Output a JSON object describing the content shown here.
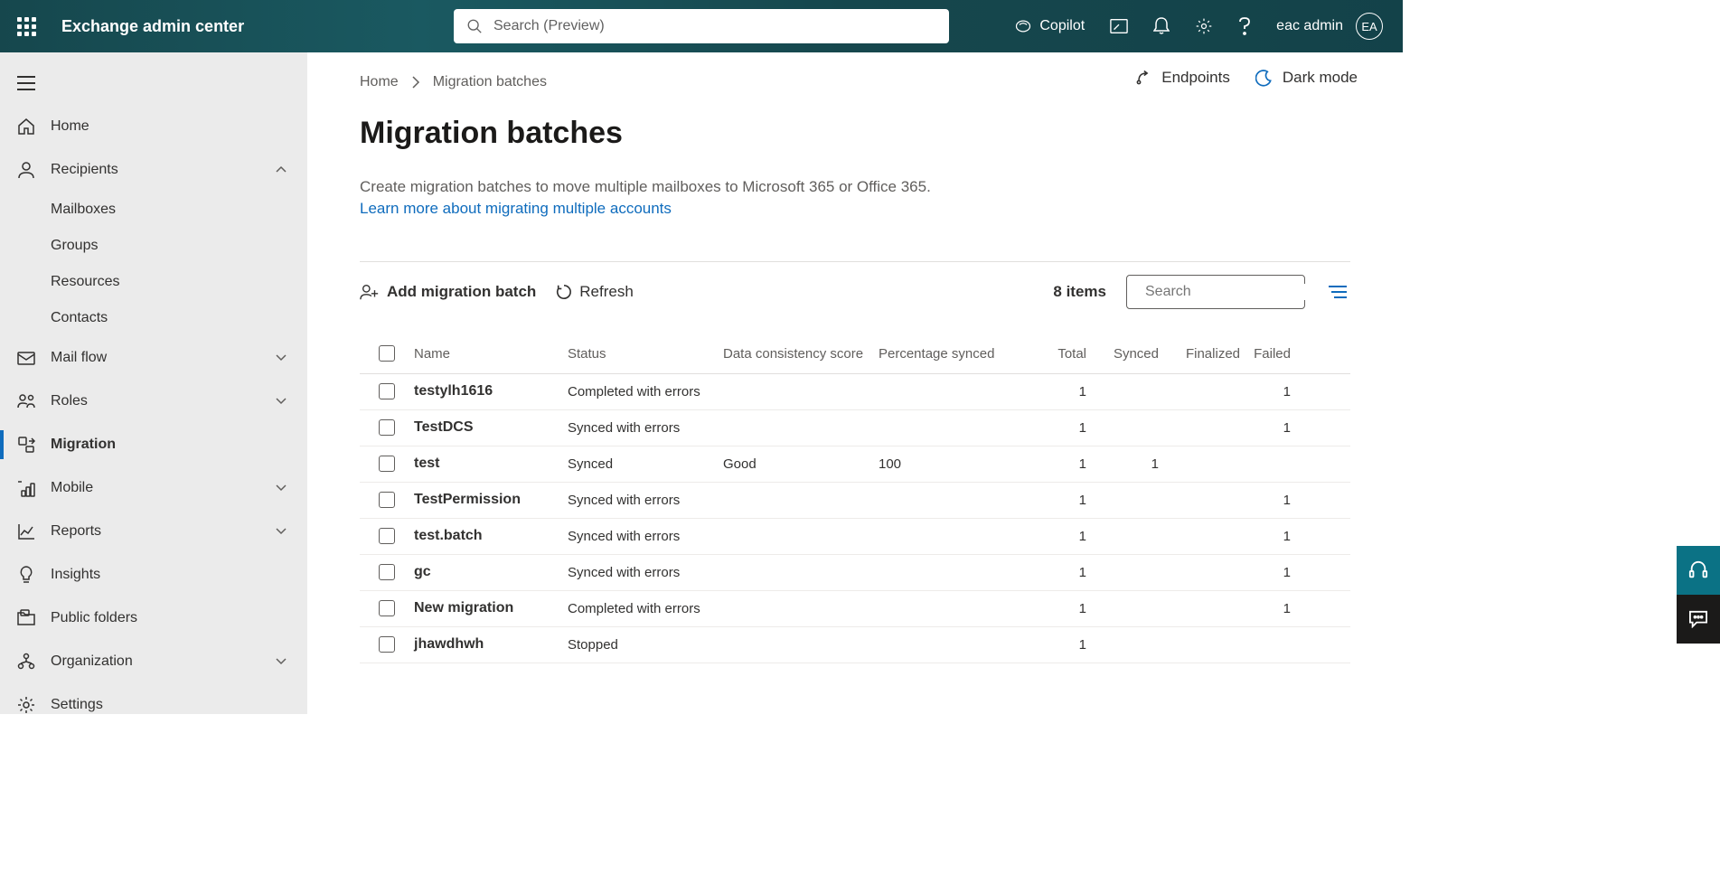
{
  "header": {
    "app_title": "Exchange admin center",
    "search_placeholder": "Search (Preview)",
    "copilot_label": "Copilot",
    "user_name": "eac admin",
    "user_initials": "EA"
  },
  "sidebar": {
    "items": [
      {
        "label": "Home",
        "icon": "home"
      },
      {
        "label": "Recipients",
        "icon": "person",
        "expanded": true,
        "children": [
          "Mailboxes",
          "Groups",
          "Resources",
          "Contacts"
        ]
      },
      {
        "label": "Mail flow",
        "icon": "mail",
        "expandable": true
      },
      {
        "label": "Roles",
        "icon": "roles",
        "expandable": true
      },
      {
        "label": "Migration",
        "icon": "migration",
        "active": true
      },
      {
        "label": "Mobile",
        "icon": "mobile",
        "expandable": true
      },
      {
        "label": "Reports",
        "icon": "chart",
        "expandable": true
      },
      {
        "label": "Insights",
        "icon": "bulb"
      },
      {
        "label": "Public folders",
        "icon": "folder"
      },
      {
        "label": "Organization",
        "icon": "org",
        "expandable": true
      },
      {
        "label": "Settings",
        "icon": "gear"
      }
    ]
  },
  "breadcrumb": {
    "home": "Home",
    "current": "Migration batches"
  },
  "page": {
    "title": "Migration batches",
    "description": "Create migration batches to move multiple mailboxes to Microsoft 365 or Office 365.",
    "learn_more": "Learn more about migrating multiple accounts",
    "endpoints_label": "Endpoints",
    "dark_mode_label": "Dark mode"
  },
  "toolbar": {
    "add_label": "Add migration batch",
    "refresh_label": "Refresh",
    "item_count_label": "8 items",
    "search_placeholder": "Search"
  },
  "table": {
    "columns": [
      "Name",
      "Status",
      "Data consistency score",
      "Percentage synced",
      "Total",
      "Synced",
      "Finalized",
      "Failed"
    ],
    "rows": [
      {
        "name": "testylh1616",
        "status": "Completed with errors",
        "dcs": "",
        "pct": "",
        "total": "1",
        "synced": "",
        "finalized": "",
        "failed": "1"
      },
      {
        "name": "TestDCS",
        "status": "Synced with errors",
        "dcs": "",
        "pct": "",
        "total": "1",
        "synced": "",
        "finalized": "",
        "failed": "1"
      },
      {
        "name": "test",
        "status": "Synced",
        "dcs": "Good",
        "pct": "100",
        "total": "1",
        "synced": "1",
        "finalized": "",
        "failed": ""
      },
      {
        "name": "TestPermission",
        "status": "Synced with errors",
        "dcs": "",
        "pct": "",
        "total": "1",
        "synced": "",
        "finalized": "",
        "failed": "1"
      },
      {
        "name": "test.batch",
        "status": "Synced with errors",
        "dcs": "",
        "pct": "",
        "total": "1",
        "synced": "",
        "finalized": "",
        "failed": "1"
      },
      {
        "name": "gc",
        "status": "Synced with errors",
        "dcs": "",
        "pct": "",
        "total": "1",
        "synced": "",
        "finalized": "",
        "failed": "1"
      },
      {
        "name": "New migration",
        "status": "Completed with errors",
        "dcs": "",
        "pct": "",
        "total": "1",
        "synced": "",
        "finalized": "",
        "failed": "1"
      },
      {
        "name": "jhawdhwh",
        "status": "Stopped",
        "dcs": "",
        "pct": "",
        "total": "1",
        "synced": "",
        "finalized": "",
        "failed": ""
      }
    ]
  }
}
